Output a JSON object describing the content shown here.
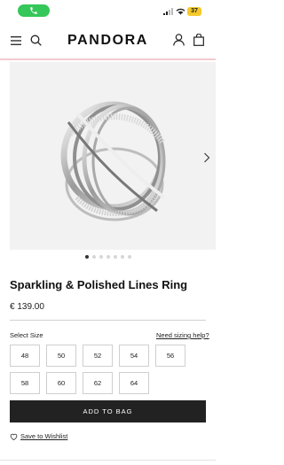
{
  "status_bar": {
    "battery": "37"
  },
  "header": {
    "logo_text": "PANDORA"
  },
  "product": {
    "title": "Sparkling & Polished Lines Ring",
    "price": "€ 139.00",
    "gallery": {
      "total_images": 7,
      "active_index": 0
    }
  },
  "sizes": {
    "label": "Select Size",
    "help_link": "Need sizing help?",
    "options": [
      "48",
      "50",
      "52",
      "54",
      "56",
      "58",
      "60",
      "62",
      "64"
    ]
  },
  "actions": {
    "add_to_bag": "ADD TO BAG",
    "wishlist": "Save to Wishlist"
  },
  "colors": {
    "call_pill": "#35c759",
    "battery": "#f5c92b",
    "header_line": "#f4c9cf",
    "button_bg": "#222222"
  }
}
